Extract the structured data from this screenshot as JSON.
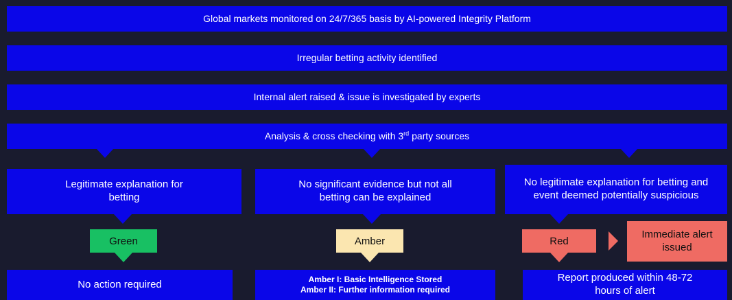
{
  "flow": {
    "step1": "Global markets monitored on 24/7/365 basis by AI-powered Integrity Platform",
    "step2": "Irregular betting activity identified",
    "step3": "Internal alert raised & issue is investigated by experts",
    "step4_pre": "Analysis & cross checking with 3",
    "step4_sup": "rd",
    "step4_post": " party sources"
  },
  "outcomes": {
    "green": {
      "description": "Legitimate explanation for betting",
      "tag": "Green",
      "tag_color": "#18c063",
      "action": "No action required"
    },
    "amber": {
      "description": "No significant evidence but not all betting can be explained",
      "tag": "Amber",
      "tag_color": "#fbe6b0",
      "action_line1": "Amber I: Basic Intelligence Stored",
      "action_line2": "Amber II: Further information required"
    },
    "red": {
      "description": "No legitimate explanation for betting and event deemed potentially suspicious",
      "tag": "Red",
      "tag_color": "#ef6b63",
      "alert": "Immediate alert issued",
      "action": "Report produced within 48-72 hours of alert"
    }
  },
  "colors": {
    "background": "#191b2e",
    "box": "#0a06e8"
  }
}
